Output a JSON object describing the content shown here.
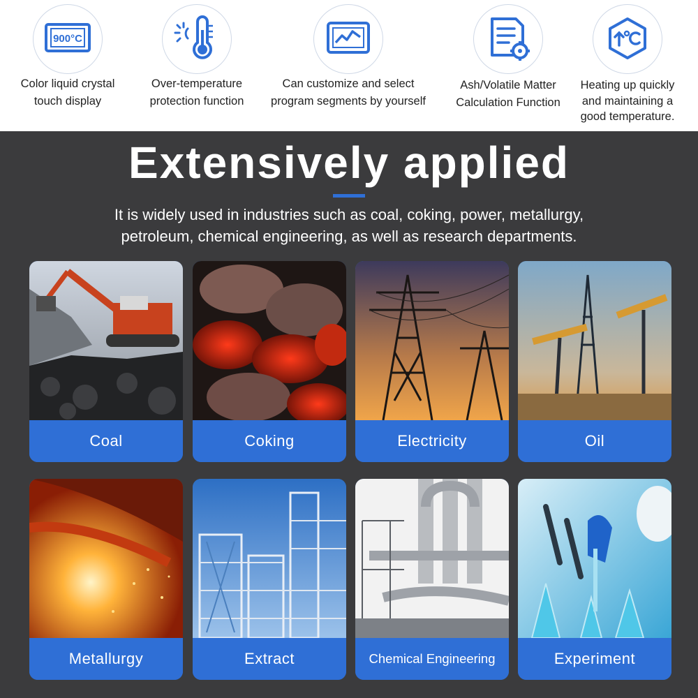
{
  "features": [
    {
      "icon": "display-900c-icon",
      "display_text": "900°C",
      "lines": [
        "Color liquid crystal",
        "touch display"
      ]
    },
    {
      "icon": "thermometer-icon",
      "lines": [
        "Over-temperature",
        "protection function"
      ]
    },
    {
      "icon": "program-chart-icon",
      "lines": [
        "Can customize and select",
        "program segments by yourself"
      ]
    },
    {
      "icon": "document-gear-icon",
      "lines": [
        "Ash/Volatile Matter",
        "Calculation Function"
      ]
    },
    {
      "icon": "heating-hexagon-icon",
      "lines": [
        "Heating up quickly",
        "and maintaining a",
        "good temperature."
      ]
    }
  ],
  "applied": {
    "title": "Extensively applied",
    "description_lines": [
      "It is widely used in industries such as coal, coking, power, metallurgy,",
      "petroleum, chemical engineering, as well as research departments."
    ],
    "cards": [
      {
        "label": "Coal",
        "image": "excavator-coal-image"
      },
      {
        "label": "Coking",
        "image": "glowing-coke-image"
      },
      {
        "label": "Electricity",
        "image": "power-tower-image"
      },
      {
        "label": "Oil",
        "image": "oil-pump-image"
      },
      {
        "label": "Metallurgy",
        "image": "molten-metal-image"
      },
      {
        "label": "Extract",
        "image": "refinery-tower-image"
      },
      {
        "label": "Chemical Engineering",
        "image": "chemical-plant-image"
      },
      {
        "label": "Experiment",
        "image": "lab-scientist-image"
      }
    ]
  },
  "colors": {
    "accent": "#2f6fd6",
    "dark_bg": "#3b3b3d",
    "icon_blue": "#2f6fd6"
  }
}
